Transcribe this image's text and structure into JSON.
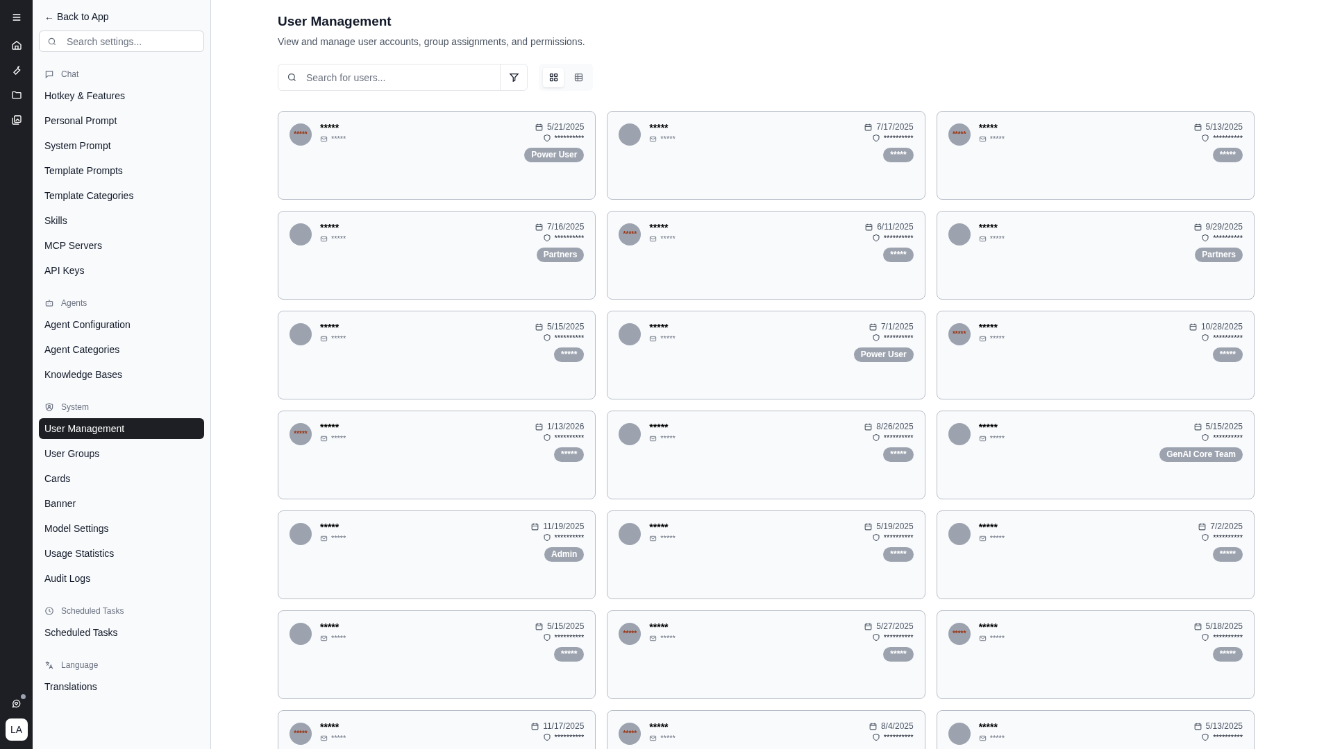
{
  "rail": {
    "avatar": "LA",
    "notification": true
  },
  "sidebar": {
    "back": "← Back to App",
    "search": {
      "placeholder": "Search settings..."
    },
    "sections": [
      {
        "label": "Chat",
        "items": [
          {
            "label": "Hotkey & Features",
            "selected": false
          },
          {
            "label": "Personal Prompt",
            "selected": false
          },
          {
            "label": "System Prompt",
            "selected": false
          },
          {
            "label": "Template Prompts",
            "selected": false
          },
          {
            "label": "Template Categories",
            "selected": false
          },
          {
            "label": "Skills",
            "selected": false
          },
          {
            "label": "MCP Servers",
            "selected": false
          },
          {
            "label": "API Keys",
            "selected": false
          }
        ]
      },
      {
        "label": "Agents",
        "items": [
          {
            "label": "Agent Configuration",
            "selected": false
          },
          {
            "label": "Agent Categories",
            "selected": false
          },
          {
            "label": "Knowledge Bases",
            "selected": false
          }
        ]
      },
      {
        "label": "System",
        "items": [
          {
            "label": "User Management",
            "selected": true
          },
          {
            "label": "User Groups",
            "selected": false
          },
          {
            "label": "Cards",
            "selected": false
          },
          {
            "label": "Banner",
            "selected": false
          },
          {
            "label": "Model Settings",
            "selected": false
          },
          {
            "label": "Usage Statistics",
            "selected": false
          },
          {
            "label": "Audit Logs",
            "selected": false
          }
        ]
      },
      {
        "label": "Scheduled Tasks",
        "items": [
          {
            "label": "Scheduled Tasks",
            "selected": false
          }
        ]
      },
      {
        "label": "Language",
        "items": [
          {
            "label": "Translations",
            "selected": false
          }
        ]
      }
    ]
  },
  "page": {
    "title": "User Management",
    "subtitle": "View and manage user accounts, group assignments, and permissions.",
    "search": {
      "placeholder": "Search for users..."
    },
    "views": [
      {
        "kind": "grid",
        "selected": true
      },
      {
        "kind": "table",
        "selected": false
      }
    ]
  },
  "users": [
    {
      "avatar": "*****",
      "name": "*****",
      "email": "*****",
      "date": "5/21/2025",
      "role": "**********",
      "group": "Power User"
    },
    {
      "name": "*****",
      "email": "*****",
      "date": "7/17/2025",
      "role": "**********",
      "group": "*****"
    },
    {
      "avatar": "*****",
      "name": "*****",
      "email": "*****",
      "date": "5/13/2025",
      "role": "**********",
      "group": "*****"
    },
    {
      "name": "*****",
      "email": "*****",
      "date": "7/16/2025",
      "role": "**********",
      "group": "Partners"
    },
    {
      "avatar": "*****",
      "name": "*****",
      "email": "*****",
      "date": "6/11/2025",
      "role": "**********",
      "group": "*****"
    },
    {
      "name": "*****",
      "email": "*****",
      "date": "9/29/2025",
      "role": "**********",
      "group": "Partners"
    },
    {
      "name": "*****",
      "email": "*****",
      "date": "5/15/2025",
      "role": "**********",
      "group": "*****"
    },
    {
      "name": "*****",
      "email": "*****",
      "date": "7/1/2025",
      "role": "**********",
      "group": "Power User"
    },
    {
      "avatar": "*****",
      "name": "*****",
      "email": "*****",
      "date": "10/28/2025",
      "role": "**********",
      "group": "*****"
    },
    {
      "avatar": "*****",
      "name": "*****",
      "email": "*****",
      "date": "1/13/2026",
      "role": "**********",
      "group": "*****"
    },
    {
      "name": "*****",
      "email": "*****",
      "date": "8/26/2025",
      "role": "**********",
      "group": "*****"
    },
    {
      "name": "*****",
      "email": "*****",
      "date": "5/15/2025",
      "role": "**********",
      "group": "GenAI Core Team"
    },
    {
      "name": "*****",
      "email": "*****",
      "date": "11/19/2025",
      "role": "**********",
      "group": "Admin"
    },
    {
      "name": "*****",
      "email": "*****",
      "date": "5/19/2025",
      "role": "**********",
      "group": "*****"
    },
    {
      "name": "*****",
      "email": "*****",
      "date": "7/2/2025",
      "role": "**********",
      "group": "*****"
    },
    {
      "name": "*****",
      "email": "*****",
      "date": "5/15/2025",
      "role": "**********",
      "group": "*****"
    },
    {
      "avatar": "*****",
      "name": "*****",
      "email": "*****",
      "date": "5/27/2025",
      "role": "**********",
      "group": "*****"
    },
    {
      "avatar": "*****",
      "name": "*****",
      "email": "*****",
      "date": "5/18/2025",
      "role": "**********",
      "group": "*****"
    },
    {
      "avatar": "*****",
      "name": "*****",
      "email": "*****",
      "date": "11/17/2025",
      "role": "**********"
    },
    {
      "avatar": "*****",
      "name": "*****",
      "email": "*****",
      "date": "8/4/2025",
      "role": "**********"
    },
    {
      "name": "*****",
      "email": "*****",
      "date": "5/13/2025",
      "role": "**********"
    }
  ]
}
